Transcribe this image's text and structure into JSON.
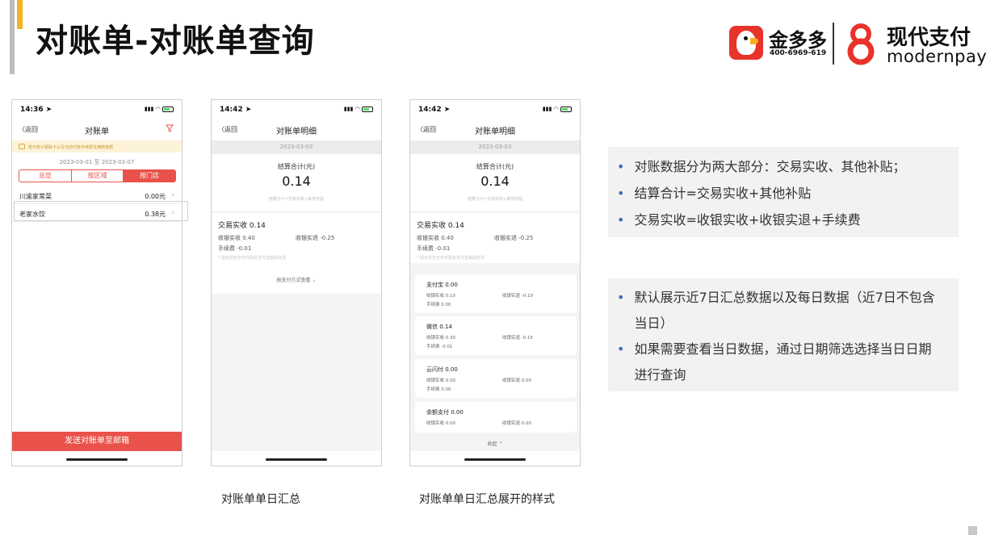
{
  "slide": {
    "title": "对账单-对账单查询",
    "captions": [
      "对账单单日汇总",
      "对账单单日汇总展开的样式"
    ]
  },
  "brand": {
    "jdd_name": "金多多",
    "jdd_phone": "400-6969-619",
    "modern_cn": "现代支付",
    "modern_en": "modernpay",
    "colors": {
      "red": "#e8332a",
      "accent": "#e9524a",
      "yellow": "#f0b424"
    }
  },
  "phone1": {
    "time": "14:36",
    "back": "返回",
    "title": "对账单",
    "notice": "暂不统计银联卡以及当前付款手续费及满赠金额",
    "date_range": "2023-03-01 至 2023-03-07",
    "tabs": [
      "总览",
      "按区域",
      "按门店"
    ],
    "active_tab": 2,
    "stores": [
      {
        "name": "川渝家常菜",
        "amount": "0.00元"
      },
      {
        "name": "老家水饺",
        "amount": "0.38元"
      }
    ],
    "send_button": "发送对账单至邮箱"
  },
  "phone2": {
    "time": "14:42",
    "back": "返回",
    "title": "对账单明细",
    "date": "2023-03-03",
    "sum_label": "结算合计(元)",
    "sum_value": "0.14",
    "sum_formula": "结算合计=交易实收+其他补贴",
    "trade_title": "交易实收  0.14",
    "cash_in": "收银实收  0.40",
    "cash_refund": "收银实退  -0.25",
    "fee": "手续费  -0.01",
    "fee_note": "* 服务费包含软件服务费与营销服务费",
    "expand": "按支付方式查看"
  },
  "phone3": {
    "time": "14:42",
    "back": "返回",
    "title": "对账单明细",
    "date": "2023-03-03",
    "sum_label": "结算合计(元)",
    "sum_value": "0.14",
    "sum_formula": "结算合计=交易实收+其他补贴",
    "trade_title": "交易实收  0.14",
    "cash_in": "收银实收  0.40",
    "cash_refund": "收银实退  -0.25",
    "fee": "手续费  -0.01",
    "fee_note": "* 服务费包含软件服务费与营销服务费",
    "methods": [
      {
        "title": "支付宝 0.00",
        "in": "收银实收  0.10",
        "refund": "收银实退  -0.10",
        "fee": "手续费  0.00"
      },
      {
        "title": "微信 0.14",
        "in": "收银实收  0.30",
        "refund": "收银实退  -0.15",
        "fee": "手续费  -0.01"
      },
      {
        "title": "云闪付 0.00",
        "in": "收银实收  0.00",
        "refund": "收银实退  0.00",
        "fee": "手续费  0.00"
      },
      {
        "title": "余额支付 0.00",
        "in": "收银实收  0.00",
        "refund": "收银实退  0.00",
        "fee": ""
      }
    ],
    "collapse": "收起"
  },
  "notes": {
    "box1": [
      "对账数据分为两大部分：交易实收、其他补贴；",
      "结算合计=交易实收+其他补贴",
      "交易实收=收银实收+收银实退+手续费"
    ],
    "box2": [
      "默认展示近7日汇总数据以及每日数据（近7日不包含当日）",
      "如果需要查看当日数据，通过日期筛选选择当日日期进行查询"
    ]
  }
}
